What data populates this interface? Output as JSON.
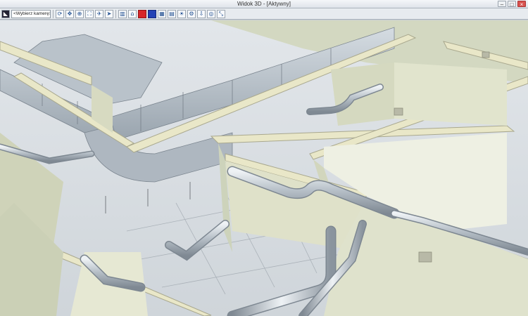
{
  "window": {
    "title": "Widok 3D - [Aktywny]",
    "controls": {
      "minimize": "–",
      "maximize": "□",
      "close": "×"
    }
  },
  "toolbar": {
    "camera_select": "<Wybierz kamerę>",
    "buttons": [
      {
        "name": "camera-tool-icon",
        "glyph": "◣"
      },
      {
        "name": "rotate-icon",
        "glyph": "⟳"
      },
      {
        "name": "pan-icon",
        "glyph": "✥"
      },
      {
        "name": "zoom-icon",
        "glyph": "⊕"
      },
      {
        "name": "zoom-extents-icon",
        "glyph": "⛶"
      },
      {
        "name": "walk-icon",
        "glyph": "✈"
      },
      {
        "name": "fly-icon",
        "glyph": "➤"
      },
      {
        "name": "section-icon",
        "glyph": "▥"
      },
      {
        "name": "building-icon",
        "glyph": "⌂"
      },
      {
        "name": "red-color-icon",
        "glyph": ""
      },
      {
        "name": "blue-color-icon",
        "glyph": ""
      },
      {
        "name": "grid-icon",
        "glyph": "▦"
      },
      {
        "name": "layers-icon",
        "glyph": "▤"
      },
      {
        "name": "light-icon",
        "glyph": "☀"
      },
      {
        "name": "settings-icon",
        "glyph": "⚙"
      },
      {
        "name": "export-icon",
        "glyph": "⇩"
      },
      {
        "name": "orbit-icon",
        "glyph": "◎"
      },
      {
        "name": "scale-icon",
        "glyph": "⤡"
      }
    ]
  },
  "colors": {
    "wall": "#e8e6c9",
    "wall_shade": "#d6d9bf",
    "floor": "#dadfe3",
    "pipe": "#b9c1c9",
    "duct": "#a9b3bc"
  }
}
